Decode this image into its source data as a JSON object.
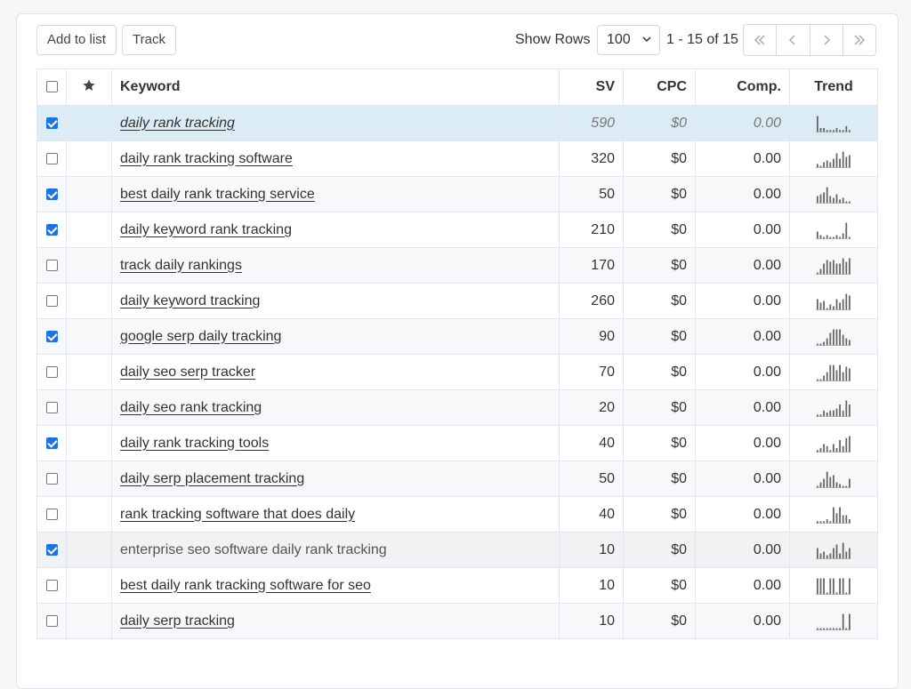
{
  "toolbar": {
    "add_to_list": "Add to list",
    "track": "Track",
    "show_rows_label": "Show Rows",
    "rows_value": "100",
    "range": "1 - 15 of 15"
  },
  "columns": {
    "keyword": "Keyword",
    "sv": "SV",
    "cpc": "CPC",
    "comp": "Comp.",
    "trend": "Trend"
  },
  "rows": [
    {
      "keyword": "daily rank tracking",
      "sv": "590",
      "cpc": "$0",
      "comp": "0.00",
      "checked": true,
      "trend": [
        8,
        2,
        2,
        1,
        1,
        1,
        2,
        1,
        1,
        3,
        1
      ]
    },
    {
      "keyword": "daily rank tracking software",
      "sv": "320",
      "cpc": "$0",
      "comp": "0.00",
      "checked": false,
      "trend": [
        2,
        1,
        3,
        4,
        3,
        5,
        8,
        5,
        9,
        6,
        7
      ]
    },
    {
      "keyword": "best daily rank tracking service",
      "sv": "50",
      "cpc": "$0",
      "comp": "0.00",
      "checked": true,
      "trend": [
        4,
        5,
        6,
        9,
        4,
        3,
        5,
        2,
        3,
        1,
        1
      ]
    },
    {
      "keyword": "daily keyword rank tracking",
      "sv": "210",
      "cpc": "$0",
      "comp": "0.00",
      "checked": true,
      "trend": [
        4,
        2,
        1,
        2,
        1,
        1,
        2,
        1,
        3,
        9,
        1
      ]
    },
    {
      "keyword": "track daily rankings",
      "sv": "170",
      "cpc": "$0",
      "comp": "0.00",
      "checked": false,
      "trend": [
        1,
        3,
        6,
        8,
        7,
        8,
        6,
        6,
        9,
        7,
        9
      ]
    },
    {
      "keyword": "daily keyword tracking",
      "sv": "260",
      "cpc": "$0",
      "comp": "0.00",
      "checked": false,
      "trend": [
        6,
        4,
        5,
        1,
        3,
        2,
        6,
        4,
        6,
        9,
        8
      ]
    },
    {
      "keyword": "google serp daily tracking",
      "sv": "90",
      "cpc": "$0",
      "comp": "0.00",
      "checked": true,
      "trend": [
        1,
        1,
        2,
        4,
        7,
        9,
        9,
        9,
        6,
        4,
        3
      ]
    },
    {
      "keyword": "daily seo serp tracker",
      "sv": "70",
      "cpc": "$0",
      "comp": "0.00",
      "checked": false,
      "trend": [
        1,
        1,
        3,
        5,
        9,
        9,
        6,
        9,
        5,
        8,
        7
      ]
    },
    {
      "keyword": "daily seo rank tracking",
      "sv": "20",
      "cpc": "$0",
      "comp": "0.00",
      "checked": false,
      "trend": [
        1,
        1,
        3,
        2,
        3,
        3,
        4,
        6,
        3,
        8,
        6
      ]
    },
    {
      "keyword": "daily rank tracking tools",
      "sv": "40",
      "cpc": "$0",
      "comp": "0.00",
      "checked": true,
      "trend": [
        1,
        2,
        4,
        3,
        1,
        4,
        2,
        6,
        3,
        7,
        8
      ]
    },
    {
      "keyword": "daily serp placement tracking",
      "sv": "50",
      "cpc": "$0",
      "comp": "0.00",
      "checked": false,
      "trend": [
        1,
        3,
        5,
        9,
        6,
        7,
        3,
        2,
        1,
        1,
        5
      ]
    },
    {
      "keyword": "rank tracking software that does daily",
      "sv": "40",
      "cpc": "$0",
      "comp": "0.00",
      "checked": false,
      "trend": [
        1,
        1,
        1,
        2,
        1,
        8,
        5,
        8,
        4,
        4,
        2
      ]
    },
    {
      "keyword": "enterprise seo software daily rank tracking",
      "sv": "10",
      "cpc": "$0",
      "comp": "0.00",
      "checked": true,
      "trend": [
        6,
        3,
        4,
        2,
        3,
        6,
        8,
        3,
        9,
        4,
        6
      ]
    },
    {
      "keyword": "best daily rank tracking software for seo",
      "sv": "10",
      "cpc": "$0",
      "comp": "0.00",
      "checked": false,
      "trend": [
        9,
        9,
        9,
        1,
        9,
        9,
        1,
        9,
        9,
        1,
        9
      ]
    },
    {
      "keyword": "daily serp tracking",
      "sv": "10",
      "cpc": "$0",
      "comp": "0.00",
      "checked": false,
      "trend": [
        1,
        1,
        1,
        1,
        1,
        1,
        1,
        1,
        9,
        1,
        9
      ]
    }
  ]
}
